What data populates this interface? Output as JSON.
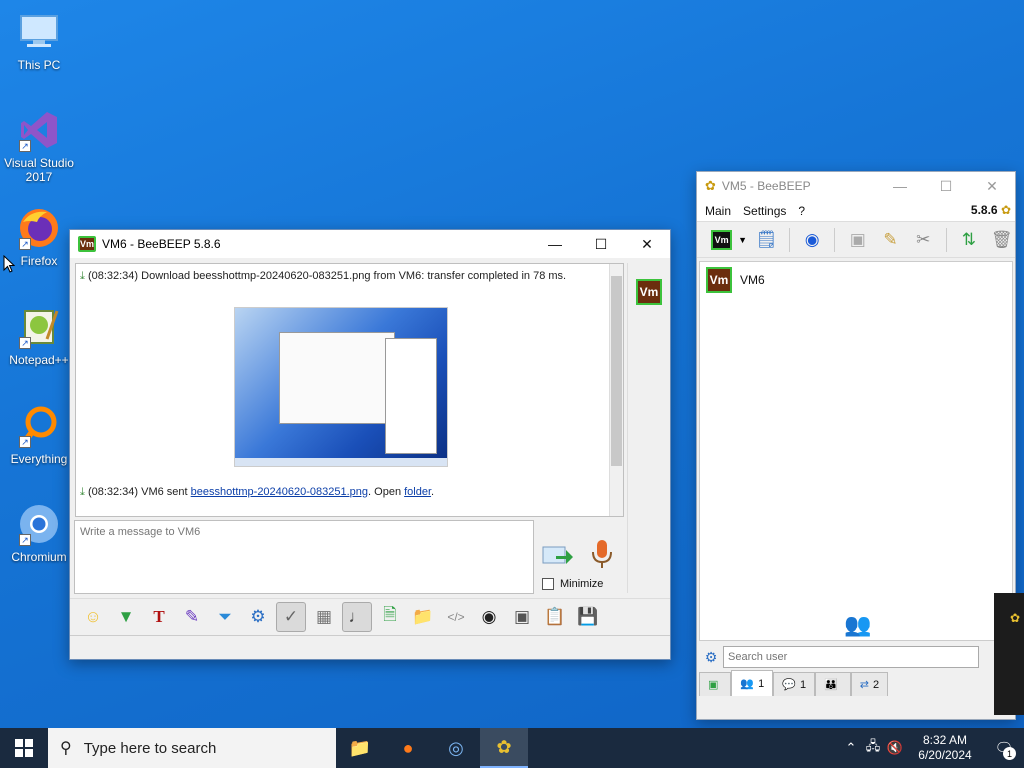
{
  "desktop": {
    "icons": [
      {
        "label": "This PC"
      },
      {
        "label": "Visual Studio 2017"
      },
      {
        "label": "Firefox"
      },
      {
        "label": "Notepad++"
      },
      {
        "label": "Everything"
      },
      {
        "label": "Chromium"
      }
    ]
  },
  "chat_window": {
    "badge": "Vm",
    "title": "VM6 - BeeBEEP 5.8.6",
    "log": {
      "line1": "(08:32:34)  Download beesshottmp-20240620-083251.png from VM6: transfer completed in 78 ms.",
      "line2_prefix": "(08:32:34)  VM6 sent ",
      "line2_link": "beesshottmp-20240620-083251.png",
      "line2_mid": ". Open ",
      "line2_link2": "folder",
      "line2_end": "."
    },
    "side_badge": "Vm",
    "message_placeholder": "Write a message to VM6",
    "minimize_label": "Minimize"
  },
  "main_window": {
    "title": "VM5 - BeeBEEP",
    "menu": [
      "Main",
      "Settings",
      "?"
    ],
    "version": "5.8.6",
    "status_badge": "Vm",
    "users": [
      {
        "badge": "Vm",
        "name": "VM6"
      }
    ],
    "search_placeholder": "Search user",
    "tabs": [
      {
        "count": ""
      },
      {
        "count": "1"
      },
      {
        "count": "1"
      },
      {
        "count": ""
      },
      {
        "count": "2"
      }
    ]
  },
  "taskbar": {
    "search_text": "Type here to search",
    "time": "8:32 AM",
    "date": "6/20/2024",
    "notification_count": "1"
  }
}
